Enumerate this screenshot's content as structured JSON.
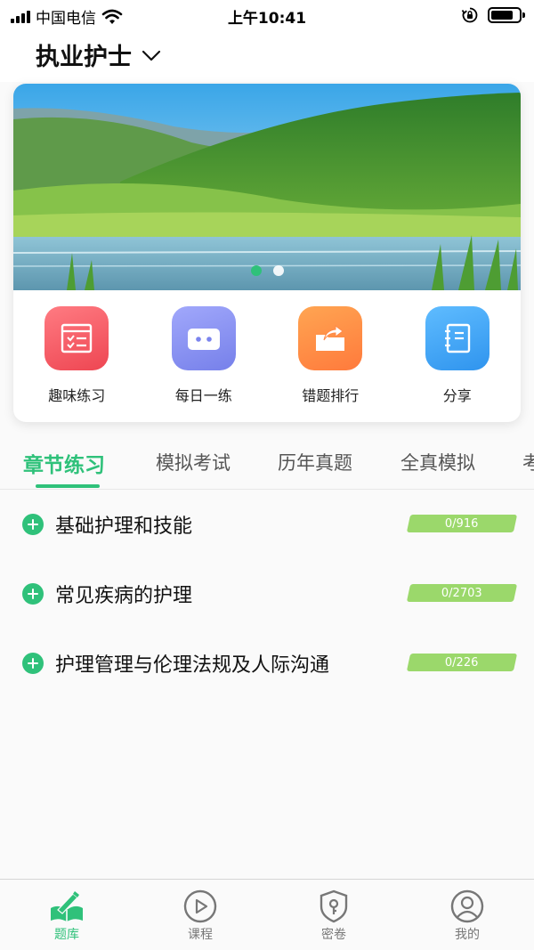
{
  "status_bar": {
    "carrier": "中国电信",
    "time": "上午10:41",
    "battery_level": 0.7
  },
  "header": {
    "title": "执业护士",
    "dropdown_icon": "chevron-down-icon"
  },
  "banner": {
    "image": "lake-hills-landscape",
    "slides": 2,
    "active_slide": 1
  },
  "shortcuts": [
    {
      "label": "趣味练习",
      "icon": "practice-checklist-icon",
      "color": "#f4606a"
    },
    {
      "label": "每日一练",
      "icon": "robot-icon",
      "color": "#8a93f3"
    },
    {
      "label": "错题排行",
      "icon": "folder-export-icon",
      "color": "#ff8a48"
    },
    {
      "label": "分享",
      "icon": "notebook-icon",
      "color": "#3fa6f5"
    }
  ],
  "tabs": [
    {
      "label": "章节练习",
      "active": true
    },
    {
      "label": "模拟考试",
      "active": false
    },
    {
      "label": "历年真题",
      "active": false
    },
    {
      "label": "全真模拟",
      "active": false
    },
    {
      "label": "考",
      "active": false
    }
  ],
  "chapters": [
    {
      "title": "基础护理和技能",
      "progress": "0/916"
    },
    {
      "title": "常见疾病的护理",
      "progress": "0/2703"
    },
    {
      "title": "护理管理与伦理法规及人际沟通",
      "progress": "0/226"
    }
  ],
  "bottom_nav": [
    {
      "label": "题库",
      "icon": "book-pen-icon",
      "active": true
    },
    {
      "label": "课程",
      "icon": "play-circle-icon",
      "active": false
    },
    {
      "label": "密卷",
      "icon": "shield-key-icon",
      "active": false
    },
    {
      "label": "我的",
      "icon": "user-circle-icon",
      "active": false
    }
  ],
  "colors": {
    "accent": "#2fc17a",
    "progress_badge": "#9bd86b"
  }
}
